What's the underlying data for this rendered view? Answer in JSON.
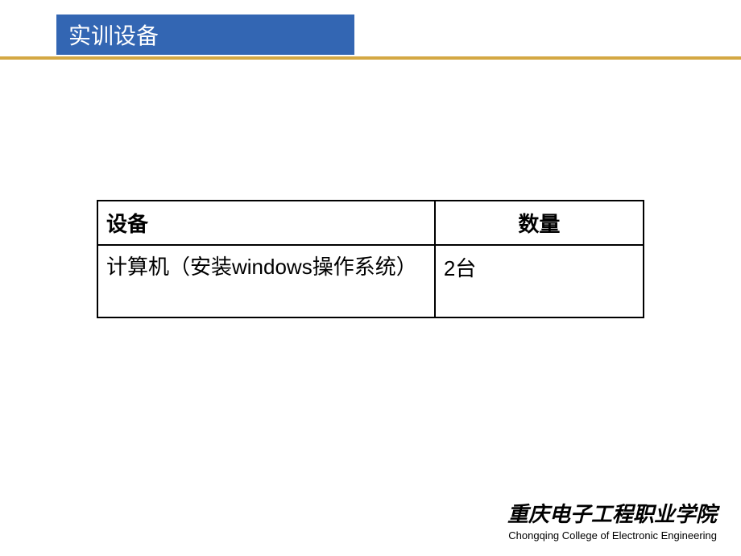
{
  "header": {
    "title": "实训设备"
  },
  "table": {
    "headers": {
      "device": "设备",
      "quantity": "数量"
    },
    "rows": [
      {
        "device": "计算机（安装windows操作系统）",
        "quantity": "2台"
      }
    ]
  },
  "footer": {
    "org_cn": "重庆电子工程职业学院",
    "org_en": "Chongqing College of Electronic Engineering"
  }
}
